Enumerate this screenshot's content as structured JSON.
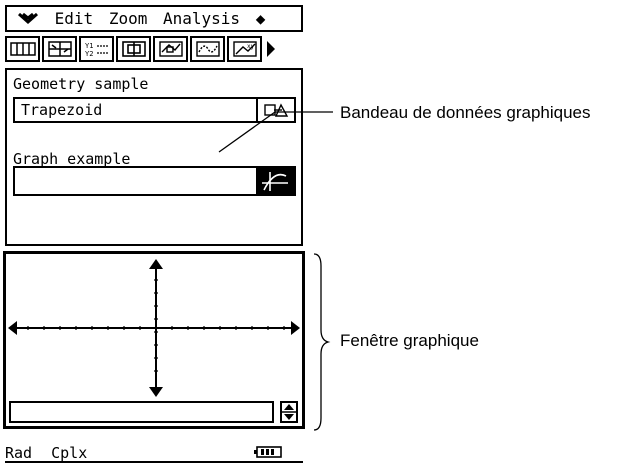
{
  "menubar": {
    "items": [
      "Edit",
      "Zoom",
      "Analysis"
    ],
    "marker": "◆"
  },
  "toolbar": {
    "icons": [
      "main-icon",
      "stat-icon",
      "graph-func-icon",
      "geometry-icon",
      "view-window-icon",
      "trace-icon",
      "sketch-icon"
    ]
  },
  "panel": {
    "geometry_label": "Geometry sample",
    "geometry_value": "Trapezoid",
    "graph_label": "Graph example",
    "graph_value": ""
  },
  "statusbar": {
    "angle": "Rad",
    "mode": "Cplx"
  },
  "annotations": {
    "strip": "Bandeau de données graphiques",
    "window": "Fenêtre graphique"
  }
}
